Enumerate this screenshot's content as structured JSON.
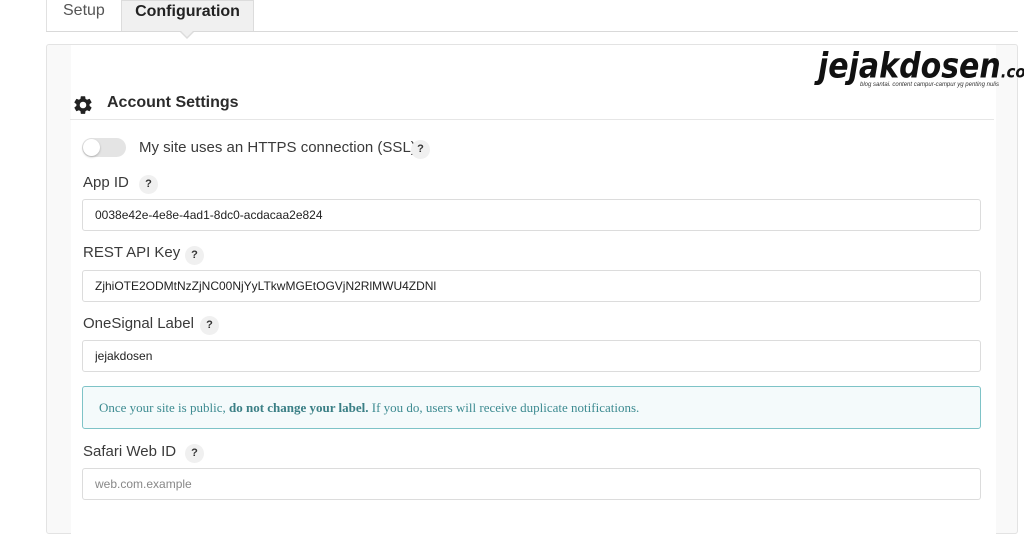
{
  "tabs": [
    {
      "label": "Setup"
    },
    {
      "label": "Configuration"
    }
  ],
  "watermark": {
    "name": "jejakdosen",
    "suffix": ".com",
    "tagline": "blog santai. content campur-campur yg penting nulis"
  },
  "section": {
    "title": "Account Settings",
    "icon": "gear-icon"
  },
  "ssl": {
    "label": "My site uses an HTTPS connection (SSL)",
    "enabled": false
  },
  "help_glyph": "?",
  "fields": {
    "app_id": {
      "label": "App ID",
      "value": "0038e42e-4e8e-4ad1-8dc0-acdacaa2e824"
    },
    "rest_api_key": {
      "label": "REST API Key",
      "value": "ZjhiOTE2ODMtNzZjNC00NjYyLTkwMGEtOGVjN2RlMWU4ZDNl"
    },
    "onesignal_label": {
      "label": "OneSignal Label",
      "value": "jejakdosen"
    },
    "safari_web_id": {
      "label": "Safari Web ID",
      "value": "",
      "placeholder": "web.com.example"
    }
  },
  "callout": {
    "before": "Once your site is public, ",
    "bold": "do not change your label.",
    "after": " If you do, users will receive duplicate notifications."
  },
  "colors": {
    "callout_border": "#7ec3c7",
    "callout_text": "#3d8b91",
    "tab_active_bg": "#f0f0f0"
  }
}
